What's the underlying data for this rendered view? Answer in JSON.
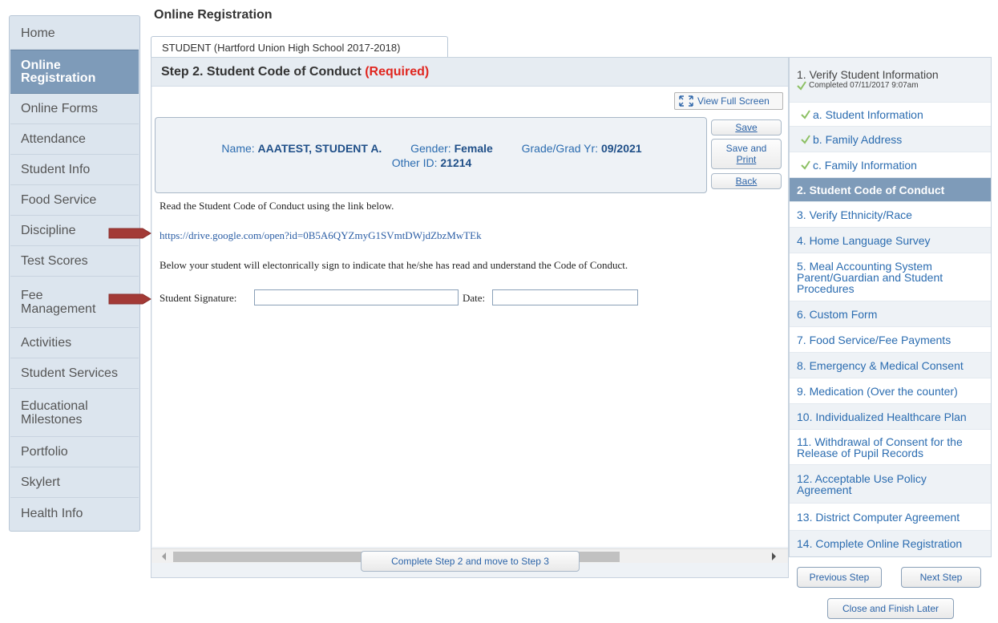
{
  "nav": {
    "items": [
      {
        "label": "Home"
      },
      {
        "label": "Online Registration",
        "active": true
      },
      {
        "label": "Online Forms"
      },
      {
        "label": "Attendance"
      },
      {
        "label": "Student Info"
      },
      {
        "label": "Food Service"
      },
      {
        "label": "Discipline"
      },
      {
        "label": "Test Scores"
      },
      {
        "label": "Fee Management"
      },
      {
        "label": "Activities"
      },
      {
        "label": "Student Services"
      },
      {
        "label": "Educational Milestones"
      },
      {
        "label": "Portfolio"
      },
      {
        "label": "Skylert"
      },
      {
        "label": "Health Info"
      }
    ]
  },
  "page": {
    "title": "Online Registration",
    "tab": "STUDENT (Hartford Union High School 2017-2018)"
  },
  "step": {
    "title": "Step 2. Student Code of Conduct",
    "required": "(Required)",
    "fullscreen": "View Full Screen"
  },
  "student": {
    "name_label": "Name:",
    "name": "AAATEST, STUDENT A.",
    "gender_label": "Gender:",
    "gender": "Female",
    "grade_label": "Grade/Grad Yr:",
    "grade": "09/2021",
    "other_id_label": "Other ID:",
    "other_id": "21214"
  },
  "buttons": {
    "save": "Save",
    "save_print_1": "Save and",
    "save_print_2": "Print",
    "back": "Back",
    "complete": "Complete Step 2 and move to Step 3",
    "previous": "Previous Step",
    "next": "Next Step",
    "close": "Close and Finish Later"
  },
  "body": {
    "instruction": "Read the Student Code of Conduct using the link below.",
    "link": "https://drive.google.com/open?id=0B5A6QYZmyG1SVmtDWjdZbzMwTEk",
    "sign_note": "Below your student will electonrically sign to indicate that he/she has read and understand the Code of Conduct.",
    "signature_label": "Student Signature:",
    "date_label": "Date:",
    "signature_value": "",
    "date_value": ""
  },
  "steps": {
    "s1": "1. Verify Student Information",
    "s1_completed": "Completed 07/11/2017 9:07am",
    "s1a": "a. Student Information",
    "s1b": "b. Family Address",
    "s1c": "c. Family Information",
    "s2": "2. Student Code of Conduct",
    "s3": "3. Verify Ethnicity/Race",
    "s4": "4. Home Language Survey",
    "s5": "5. Meal Accounting System Parent/Guardian and Student Procedures",
    "s6": "6. Custom Form",
    "s7": "7. Food Service/Fee Payments",
    "s8": "8. Emergency & Medical Consent",
    "s9": "9. Medication (Over the counter)",
    "s10": "10. Individualized Healthcare Plan",
    "s11": "11. Withdrawal of Consent for the Release of Pupil Records",
    "s12": "12. Acceptable Use Policy Agreement",
    "s13": "13. District Computer Agreement",
    "s14": "14. Complete Online Registration"
  },
  "colors": {
    "accent": "#7e9bb9",
    "required": "#e0261f",
    "link": "#2b6cb0",
    "annotation_arrow": "#a33a36"
  }
}
